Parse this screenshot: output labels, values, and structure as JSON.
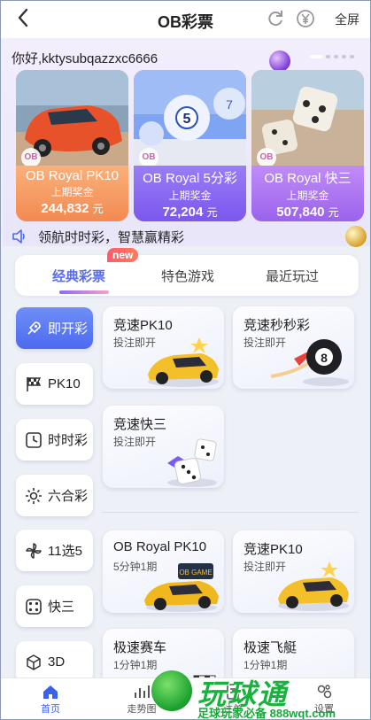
{
  "header": {
    "back_icon": "chevron-left-icon",
    "title": "OB彩票",
    "fullscreen_label": "全屏"
  },
  "greeting": "你好,kktysubqazzxc6666",
  "banner": [
    {
      "name": "OB Royal PK10",
      "sub": "上期奖金",
      "amount": "244,832",
      "unit": "元"
    },
    {
      "name": "OB Royal 5分彩",
      "sub": "上期奖金",
      "amount": "72,204",
      "unit": "元"
    },
    {
      "name": "OB Royal 快三",
      "sub": "上期奖金",
      "amount": "507,840",
      "unit": "元"
    }
  ],
  "marquee": "领航时时彩，智慧赢精彩",
  "tabs": [
    {
      "label": "经典彩票",
      "active": true,
      "badge": "new"
    },
    {
      "label": "特色游戏",
      "active": false
    },
    {
      "label": "最近玩过",
      "active": false
    }
  ],
  "categories": [
    {
      "label": "即开彩",
      "icon": "rocket-icon",
      "active": true
    },
    {
      "label": "PK10",
      "icon": "checkered-flag-icon",
      "active": false
    },
    {
      "label": "时时彩",
      "icon": "clock-icon",
      "active": false
    },
    {
      "label": "六合彩",
      "icon": "sun-burst-icon",
      "active": false
    },
    {
      "label": "11选5",
      "icon": "pinwheel-icon",
      "active": false
    },
    {
      "label": "快三",
      "icon": "dice-icon",
      "active": false
    },
    {
      "label": "3D",
      "icon": "cube-icon",
      "active": false
    }
  ],
  "games": [
    {
      "name": "竞速PK10",
      "sub": "投注即开"
    },
    {
      "name": "竞速秒秒彩",
      "sub": "投注即开"
    },
    {
      "name": "竞速快三",
      "sub": "投注即开"
    },
    {
      "name": "OB Royal PK10",
      "sub": "5分钟1期"
    },
    {
      "name": "竞速PK10",
      "sub": "投注即开"
    },
    {
      "name": "极速赛车",
      "sub": "1分钟1期"
    },
    {
      "name": "极速飞艇",
      "sub": "1分钟1期"
    }
  ],
  "bottom_nav": [
    {
      "label": "首页",
      "active": true
    },
    {
      "label": "走势图",
      "active": false
    },
    {
      "label": "注单",
      "active": false
    },
    {
      "label": "设置",
      "active": false
    }
  ],
  "watermark": {
    "title": "玩球通",
    "subtitle": "足球玩家必备 888wqt.com"
  },
  "colors": {
    "accent": "#4d6af0",
    "badge": "#ff5b6e"
  }
}
